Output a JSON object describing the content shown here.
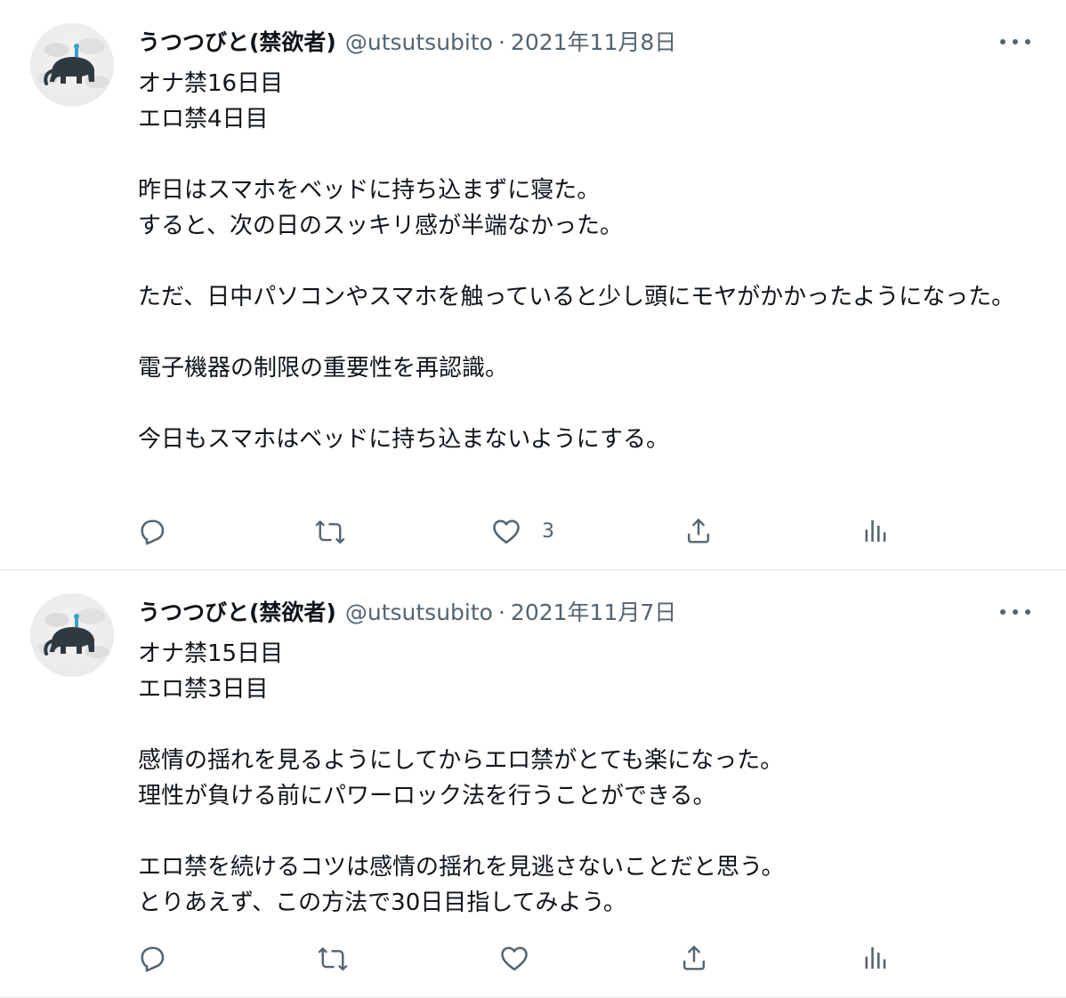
{
  "tweets": [
    {
      "name": "うつつびと(禁欲者)",
      "handle": "@utsutsubito",
      "separator": "·",
      "date": "2021年11月8日",
      "text": "オナ禁16日目\nエロ禁4日目\n\n昨日はスマホをベッドに持ち込まずに寝た。\nすると、次の日のスッキリ感が半端なかった。\n\nただ、日中パソコンやスマホを触っていると少し頭にモヤがかかったようになった。\n\n電子機器の制限の重要性を再認識。\n\n今日もスマホはベッドに持ち込まないようにする。",
      "like_count": "3"
    },
    {
      "name": "うつつびと(禁欲者)",
      "handle": "@utsutsubito",
      "separator": "·",
      "date": "2021年11月7日",
      "text": "オナ禁15日目\nエロ禁3日目\n\n感情の揺れを見るようにしてからエロ禁がとても楽になった。\n理性が負ける前にパワーロック法を行うことができる。\n\nエロ禁を続けるコツは感情の揺れを見逃さないことだと思う。\nとりあえず、この方法で30日目指してみよう。",
      "like_count": ""
    }
  ],
  "icons": [
    "avatar-elephant-icon",
    "more-icon",
    "reply-icon",
    "retweet-icon",
    "like-icon",
    "share-icon",
    "analytics-icon"
  ],
  "colors": {
    "text": "#0f1419",
    "secondary": "#536471",
    "divider": "#e7e9ea"
  }
}
